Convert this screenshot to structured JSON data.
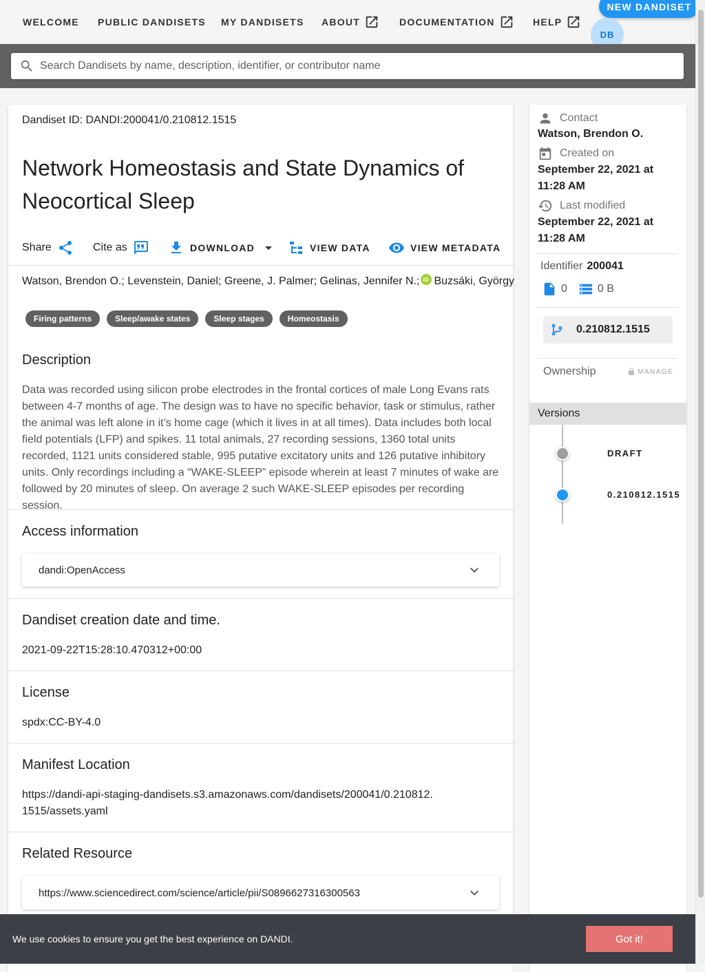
{
  "nav": {
    "items": [
      {
        "label": "WELCOME",
        "external": false
      },
      {
        "label": "PUBLIC DANDISETS",
        "external": false
      },
      {
        "label": "MY DANDISETS",
        "external": false
      },
      {
        "label": "ABOUT",
        "external": true
      },
      {
        "label": "DOCUMENTATION",
        "external": true
      },
      {
        "label": "HELP",
        "external": true
      }
    ],
    "new_dandiset_label": "NEW DANDISET",
    "avatar_initials": "DB"
  },
  "search": {
    "placeholder": "Search Dandisets by name, description, identifier, or contributor name",
    "value": ""
  },
  "dandiset": {
    "id_line": "Dandiset ID: DANDI:200041/0.210812.1515",
    "title": "Network Homeostasis and State Dynamics of Neocortical Sleep",
    "actions": {
      "share": "Share",
      "cite": "Cite as",
      "download": "DOWNLOAD",
      "view_data": "VIEW DATA",
      "view_metadata": "VIEW METADATA"
    },
    "contributors": [
      {
        "name": "Watson, Brendon O.;",
        "orcid": false
      },
      {
        "name": "Levenstein, Daniel;",
        "orcid": false
      },
      {
        "name": "Greene, J. Palmer;",
        "orcid": false
      },
      {
        "name": "Gelinas, Jennifer N.;",
        "orcid": true
      },
      {
        "name": "Buzsáki, György",
        "orcid": false
      }
    ],
    "orcid_mark": "iD",
    "keywords": [
      "Firing patterns",
      "Sleep/awake states",
      "Sleep stages",
      "Homeostasis"
    ],
    "description_title": "Description",
    "description": "Data was recorded using silicon probe electrodes in the frontal cortices of male Long Evans rats between 4-7 months of age. The design was to have no specific behavior, task or stimulus, rather the animal was left alone in it’s home cage (which it lives in at all times). Data includes both local field potentials (LFP) and spikes. 11 total animals, 27 recording sessions, 1360 total units recorded, 1121 units considered stable, 995 putative excitatory units and 126 putative inhibitory units. Only recordings including a “WAKE-SLEEP” episode wherein at least 7 minutes of wake are followed by 20 minutes of sleep. On average 2 such WAKE-SLEEP episodes per recording session.",
    "access_title": "Access information",
    "access_value": "dandi:OpenAccess",
    "created_title": "Dandiset creation date and time.",
    "created_value": "2021-09-22T15:28:10.470312+00:00",
    "license_title": "License",
    "license_value": "spdx:CC-BY-4.0",
    "manifest_title": "Manifest Location",
    "manifest_value": "https://dandi-api-staging-dandisets.s3.amazonaws.com/dandisets/200041/0.210812.1515/assets.yaml",
    "related_title": "Related Resource",
    "related_value": "https://www.sciencedirect.com/science/article/pii/S0896627316300563"
  },
  "sidebar": {
    "contact_label": "Contact",
    "contact_value": "Watson, Brendon O.",
    "created_label": "Created on",
    "created_value": "September 22, 2021 at 11:28 AM",
    "modified_label": "Last modified",
    "modified_value": "September 22, 2021 at 11:28 AM",
    "identifier_label": "Identifier",
    "identifier_value": "200041",
    "file_count": "0",
    "size": "0 B",
    "current_version": "0.210812.1515",
    "ownership_label": "Ownership",
    "manage_label": "MANAGE",
    "versions_label": "Versions",
    "versions": [
      {
        "label": "DRAFT",
        "color": "#9e9e9e"
      },
      {
        "label": "0.210812.1515",
        "color": "#2196f3"
      }
    ]
  },
  "cookie": {
    "message": "We use cookies to ensure you get the best experience on DANDI.",
    "button_label": "Got it!"
  },
  "colors": {
    "accent": "#2196f3",
    "search_band": "#616161",
    "cookie_bg": "#3c3f45",
    "cookie_button": "#e57373"
  }
}
